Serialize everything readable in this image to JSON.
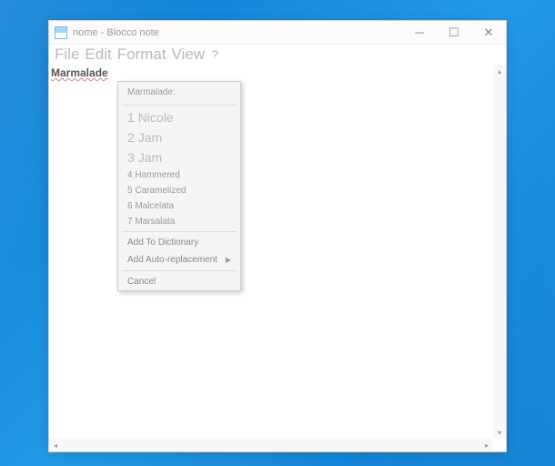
{
  "window": {
    "title": "nome - Blocco note"
  },
  "menubar": {
    "file": "File",
    "edit": "Edit",
    "format": "Format",
    "view": "View",
    "help": "?"
  },
  "document": {
    "text": "Marmalade"
  },
  "context_menu": {
    "header": "Marmalade:",
    "suggestions": [
      {
        "n": "1",
        "word": "Nicole"
      },
      {
        "n": "2",
        "word": "Jam"
      },
      {
        "n": "3",
        "word": "Jam"
      },
      {
        "n": "4",
        "word": "Hammered"
      },
      {
        "n": "5",
        "word": "Caramelized"
      },
      {
        "n": "6",
        "word": "Malcelata"
      },
      {
        "n": "7",
        "word": "Marsalata"
      }
    ],
    "add_dictionary": "Add To Dictionary",
    "add_autoreplace": "Add Auto-replacement",
    "cancel": "Cancel"
  }
}
